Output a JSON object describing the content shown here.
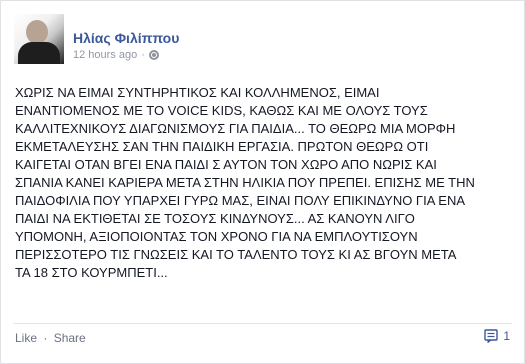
{
  "post": {
    "author": "Ηλίας Φιλίππου",
    "time": "12 hours ago",
    "text": "ΧΩΡΙΣ ΝΑ ΕΙΜΑΙ ΣΥΝΤΗΡΗΤΙΚΟΣ ΚΑΙ ΚΟΛΛΗΜΕΝΟΣ, ΕΙΜΑΙ\nΕΝΑΝΤΙΟΜΕΝΟΣ ΜΕ ΤΟ VOICE KIDS, ΚΑΘΩΣ ΚΑΙ ΜΕ ΟΛΟΥΣ ΤΟΥΣ\nΚΑΛΛΙΤΕΧΝΙΚΟΥΣ ΔΙΑΓΩΝΙΣΜΟΥΣ ΓΙΑ ΠΑΙΔΙΑ... ΤΟ ΘΕΩΡΩ ΜΙΑ ΜΟΡΦΗ\nΕΚΜΕΤΑΛΕΥΣΗΣ ΣΑΝ ΤΗΝ ΠΑΙΔΙΚΗ ΕΡΓΑΣΙΑ. ΠΡΩΤΟΝ ΘΕΩΡΩ ΟΤΙ\nΚΑΙΓΕΤΑΙ ΟΤΑΝ ΒΓΕΙ ΕΝΑ ΠΑΙΔΙ Σ ΑΥΤΟΝ ΤΟΝ ΧΩΡΟ ΑΠΟ ΝΩΡΙΣ ΚΑΙ\nΣΠΑΝΙΑ ΚΑΝΕΙ ΚΑΡΙΕΡΑ ΜΕΤΑ ΣΤΗΝ ΗΛΙΚΙΑ ΠΟΥ ΠΡΕΠΕΙ. ΕΠΙΣΗΣ ΜΕ ΤΗΝ\nΠΑΙΔΟΦΙΛΙΑ ΠΟΥ ΥΠΑΡΧΕΙ ΓΥΡΩ ΜΑΣ, ΕΙΝΑΙ ΠΟΛΥ ΕΠΙΚΙΝΔΥΝΟ ΓΙΑ ΕΝΑ\nΠΑΙΔΙ ΝΑ ΕΚΤΙΘΕΤΑΙ ΣΕ ΤΟΣΟΥΣ ΚΙΝΔΥΝΟΥΣ... ΑΣ ΚΑΝΟΥΝ ΛΙΓΟ\nΥΠΟΜΟΝΗ, ΑΞΙΟΠΟΙΟΝΤΑΣ ΤΟΝ ΧΡΟΝΟ ΓΙΑ ΝΑ ΕΜΠΛΟΥΤΙΣΟΥΝ\nΠΕΡΙΣΣΟΤΕΡΟ ΤΙΣ ΓΝΩΣΕΙΣ ΚΑΙ ΤΟ ΤΑΛΕΝΤΟ ΤΟΥΣ ΚΙ ΑΣ ΒΓΟΥΝ ΜΕΤΑ\nΤΑ 18 ΣΤΟ ΚΟΥΡΜΠΕΤΙ..."
  },
  "actions": {
    "like_label": "Like",
    "separator": "·",
    "share_label": "Share",
    "comment_count": "1"
  },
  "icons": {
    "privacy": "globe-icon",
    "comments": "comment-icon"
  },
  "colors": {
    "author_link": "#3b5998",
    "meta": "#9197a3",
    "text": "#141823"
  }
}
